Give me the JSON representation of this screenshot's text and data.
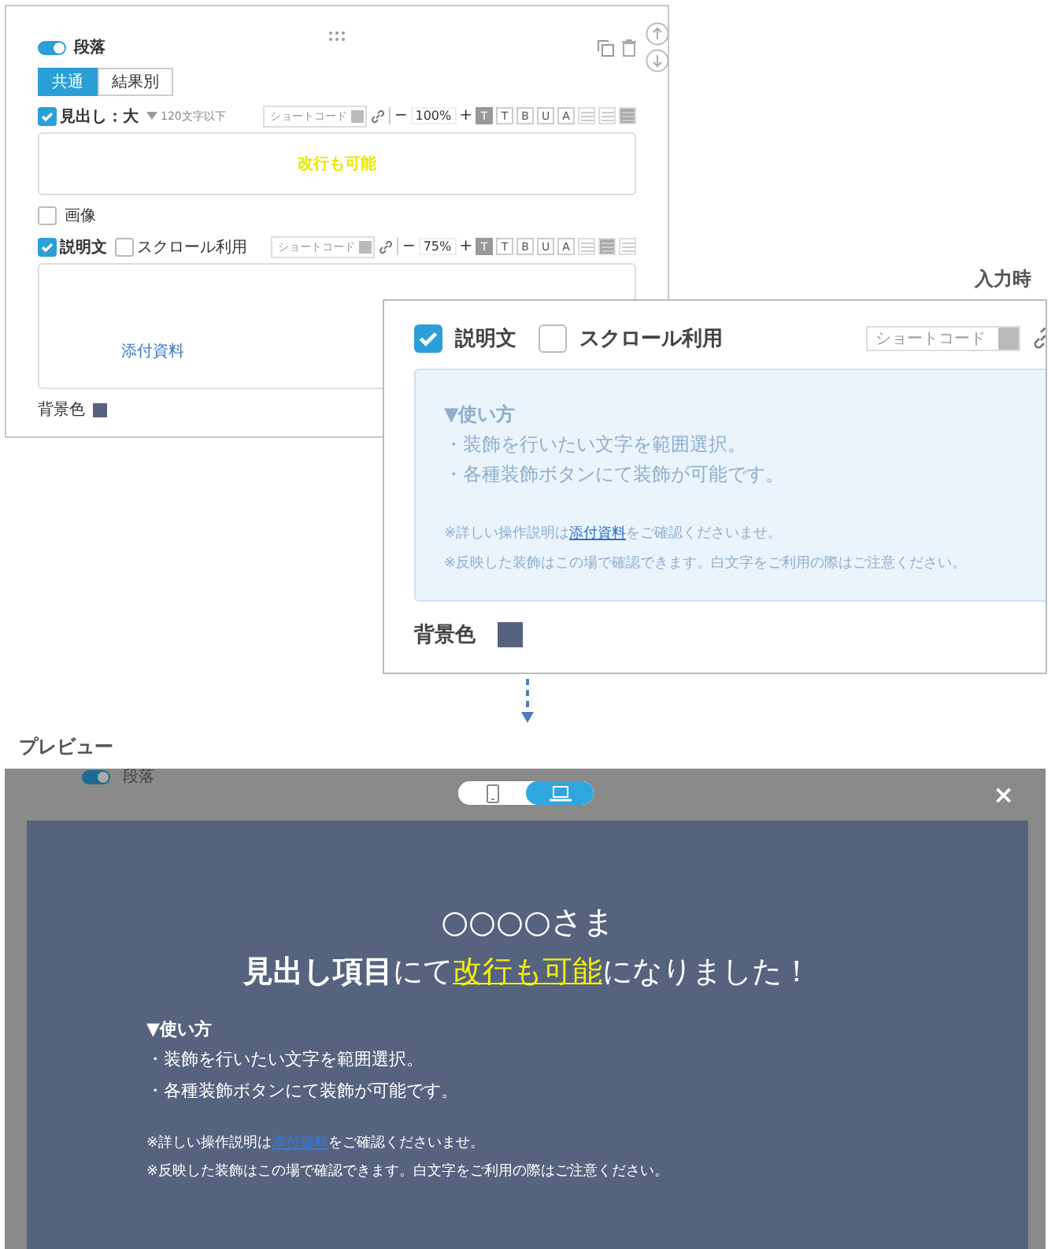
{
  "editor": {
    "toggle": {
      "label": "段落",
      "on": true
    },
    "tabs": [
      {
        "label": "共通",
        "selected": true
      },
      {
        "label": "結果別",
        "selected": false
      }
    ],
    "heading_field": {
      "checked": true,
      "label": "見出し：大",
      "hint": "120文字以下",
      "shortcode": "ショートコード",
      "minus": "−",
      "size": "100%",
      "plus": "+",
      "format_buttons": [
        {
          "label": "T",
          "selected": true
        },
        {
          "label": "T",
          "selected": false
        },
        {
          "label": "B",
          "selected": false
        },
        {
          "label": "U",
          "selected": false
        },
        {
          "label": "A",
          "selected": false
        }
      ],
      "align_buttons": [
        {
          "selected": false
        },
        {
          "selected": false
        },
        {
          "selected": true
        }
      ],
      "text": "改行も可能"
    },
    "image_option": {
      "label": "画像",
      "checked": false
    },
    "description_field": {
      "checked": true,
      "label": "説明文",
      "scroll": {
        "label": "スクロール利用",
        "checked": false
      },
      "shortcode": "ショートコード",
      "minus": "−",
      "size": "75%",
      "plus": "+",
      "format_buttons": [
        {
          "label": "T",
          "selected": true
        },
        {
          "label": "T",
          "selected": false
        },
        {
          "label": "B",
          "selected": false
        },
        {
          "label": "U",
          "selected": false
        },
        {
          "label": "A",
          "selected": false
        }
      ],
      "align_buttons": [
        {
          "selected": false
        },
        {
          "selected": true
        },
        {
          "selected": false
        }
      ],
      "link": "添付資料"
    },
    "background": {
      "label": "背景色",
      "color": "#56637f"
    }
  },
  "input_view": {
    "caption": "入力時",
    "description": {
      "label": "説明文",
      "checked": true
    },
    "scroll": {
      "label": "スクロール利用",
      "checked": false
    },
    "shortcode": "ショートコード",
    "usage_title": "▼使い方",
    "lines": [
      "・装飾を行いたい文字を範囲選択。",
      "・各種装飾ボタンにて装飾が可能です。"
    ],
    "note_1": {
      "before": "※詳しい操作説明は",
      "link": "添付資料",
      "after": "をご確認くださいませ。"
    },
    "note_2": "※反映した装飾はこの場で確認できます。白文字をご利用の際はご注意ください。",
    "background": {
      "label": "背景色",
      "color": "#56637f"
    }
  },
  "preview": {
    "caption": "プレビュー",
    "behind_toggle": {
      "on": true
    },
    "behind_label": "段落",
    "devices": [
      {
        "kind": "phone",
        "selected": false
      },
      {
        "kind": "laptop",
        "selected": true
      }
    ],
    "close": "×",
    "recipient": "○○○○さま",
    "heading": [
      {
        "text": "見出し項目",
        "kind": "bold"
      },
      {
        "text": "にて",
        "kind": "plain"
      },
      {
        "text": "改行も可能",
        "kind": "highlight"
      },
      {
        "text": "になりました！",
        "kind": "plain"
      }
    ],
    "usage_title": "▼使い方",
    "lines": [
      "・装飾を行いたい文字を範囲選択。",
      "・各種装飾ボタンにて装飾が可能です。"
    ],
    "note_1": {
      "before": "※詳しい操作説明は",
      "link": "添付資料",
      "after": "をご確認くださいませ。"
    },
    "note_2": "※反映した装飾はこの場で確認できます。白文字をご利用の際はご注意ください。"
  }
}
